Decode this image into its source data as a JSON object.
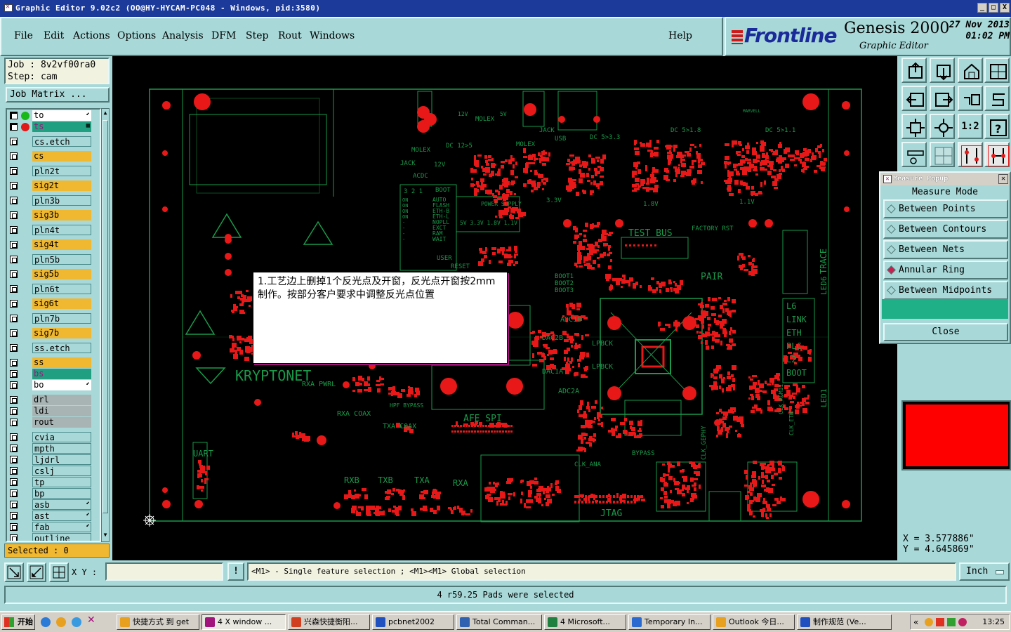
{
  "window": {
    "title": "Graphic Editor 9.02c2  (OO@HY-HYCAM-PC048 - Windows, pid:3580)",
    "min": "_",
    "max": "□",
    "close": "X"
  },
  "menu": [
    "File",
    "Edit",
    "Actions",
    "Options",
    "Analysis",
    "DFM",
    "Step",
    "Rout",
    "Windows"
  ],
  "help_label": "Help",
  "brand": {
    "logo": "Frontline",
    "product": "Genesis 2000",
    "subtitle": "Graphic Editor",
    "date": "27 Nov 2013",
    "time": "01:02 PM"
  },
  "job": {
    "job_line": "Job : 8v2vf00ra0",
    "step_line": "Step: cam",
    "matrix_label": "Job Matrix ..."
  },
  "layers": [
    {
      "name": "to",
      "style": "w",
      "dot": "#18b818",
      "checked": true,
      "flag": "⬋"
    },
    {
      "name": "ts",
      "style": "t",
      "dot": "#e01818",
      "checked": true,
      "flag": "▦"
    },
    {
      "name": "cs.etch",
      "style": "c"
    },
    {
      "name": "cs",
      "style": "y"
    },
    {
      "name": "pln2t",
      "style": "c"
    },
    {
      "name": "sig2t",
      "style": "y"
    },
    {
      "name": "pln3b",
      "style": "c"
    },
    {
      "name": "sig3b",
      "style": "y"
    },
    {
      "name": "pln4t",
      "style": "c"
    },
    {
      "name": "sig4t",
      "style": "y"
    },
    {
      "name": "pln5b",
      "style": "c"
    },
    {
      "name": "sig5b",
      "style": "y"
    },
    {
      "name": "pln6t",
      "style": "c"
    },
    {
      "name": "sig6t",
      "style": "y"
    },
    {
      "name": "pln7b",
      "style": "c"
    },
    {
      "name": "sig7b",
      "style": "y"
    },
    {
      "name": "ss.etch",
      "style": "c"
    },
    {
      "name": "ss",
      "style": "y"
    },
    {
      "name": "bs",
      "style": "t"
    },
    {
      "name": "bo",
      "style": "w",
      "flag": "⬋"
    },
    {
      "name": "drl",
      "style": "g"
    },
    {
      "name": "ldi",
      "style": "g"
    },
    {
      "name": "rout",
      "style": "g"
    },
    {
      "name": "cvia",
      "style": "c"
    },
    {
      "name": "mpth",
      "style": "c"
    },
    {
      "name": "ljdrl",
      "style": "c"
    },
    {
      "name": "cslj",
      "style": "c"
    },
    {
      "name": "tp",
      "style": "c"
    },
    {
      "name": "bp",
      "style": "c"
    },
    {
      "name": "asb",
      "style": "c",
      "flag": "⬋"
    },
    {
      "name": "ast",
      "style": "c",
      "flag": "⬋"
    },
    {
      "name": "fab",
      "style": "c",
      "flag": "⬋"
    },
    {
      "name": "outline",
      "style": "c"
    }
  ],
  "selected_label": "Selected : 0",
  "board_labels": {
    "kryptonet": "KRYPTONET",
    "test_bus": "TEST BUS",
    "pair": "PAIR",
    "trace": "TRACE",
    "led6": "LED6",
    "led1": "LED1",
    "afe_spi": "AFE SPI",
    "jtag": "JTAG",
    "uart": "UART",
    "rxb": "RXB",
    "txb": "TXB",
    "txa": "TXA",
    "rxa": "RXA",
    "rxa_coax": "RXA COAX",
    "txa_coax": "TXA COAX",
    "rxa_pwrl": "RXA PWRL",
    "hpf_bypass": "HPF BYPASS",
    "clk_ana": "CLK_ANA",
    "bypass": "BYPASS",
    "clk_gephy": "CLK_GEPHY",
    "dac2b": "DAC2B",
    "dac1a": "DAC1A",
    "adc1b": "ADC1B",
    "adc2a": "ADC2A",
    "lpbck1": "LPBCK",
    "lpbck2": "LPBCK",
    "boot_col": [
      "BOOT1",
      "BOOT2",
      "BOOT3"
    ],
    "molex": "MOLEX",
    "molex2": "MOLEX",
    "molex3": "MOLEX",
    "jack": "JACK",
    "jack2": "JACK",
    "usb": "USB",
    "acdc": "ACDC",
    "power_supply": "POWER\nSUPPLY",
    "dc12": "DC 12>5",
    "dc533": "DC 5>3.3",
    "dc518": "DC 5>1.8",
    "dc511": "DC 5>1.1",
    "v33": "3.3V",
    "v18": "1.8V",
    "v11": "1.1V",
    "v12": "12V",
    "v5": "5V",
    "factory_rst": "FACTORY RST",
    "user": "USER",
    "reset": "RESET",
    "boot": "BOOT",
    "right_col": [
      "L6",
      "LINK",
      "ETH",
      "PLC",
      "L2",
      "BOOT"
    ],
    "clk_rgmii": "CLK_RGMII",
    "clk_eth": "CLK_ETH",
    "marvell": "MARVELL",
    "boot_modes": [
      "AUTO",
      "FLASH",
      "ETH-B",
      "ETH-L",
      "NOPLL",
      "EXCT",
      "RAM",
      "WAIT"
    ],
    "boot_hdr": "3 2 1",
    "switch_col": [
      "ON",
      "ON",
      "ON",
      "ON",
      "-",
      "-",
      "-",
      "-"
    ],
    "volt_row": "5V 3.3V 1.8V 1.1V",
    "v12b": "12V"
  },
  "annotation": "1.工艺边上删掉1个反光点及开窗，反光点开窗按2mm制作。按部分客户要求中调整反光点位置",
  "measure_popup": {
    "title": "Measure Popup",
    "mode_label": "Measure Mode",
    "options": [
      "Between Points",
      "Between Contours",
      "Between Nets",
      "Annular Ring",
      "Between Midpoints"
    ],
    "selected_index": 3,
    "close_label": "Close"
  },
  "coords": {
    "x": "X = 3.577886\"",
    "y": "Y = 4.645869\""
  },
  "command": {
    "xy_label": "X Y :",
    "xy_value": "",
    "bang": "!",
    "hint": "<M1> - Single feature selection ; <M1><M1> Global selection",
    "unit": "Inch"
  },
  "status": "4 r59.25 Pads were selected",
  "taskbar": {
    "start": "开始",
    "items": [
      "快捷方式 到 get",
      "4 X window ...",
      "兴森快捷衡阳...",
      "pcbnet2002",
      "Total Comman...",
      "4 Microsoft...",
      "Temporary In...",
      "Outlook 今日...",
      "制作规范 (Ve..."
    ],
    "clock": "13:25"
  },
  "colors": {
    "panel": "#a8d8d8",
    "pad": "#e81818",
    "trace": "#1a9a4a",
    "title": "#1c3a9a"
  }
}
